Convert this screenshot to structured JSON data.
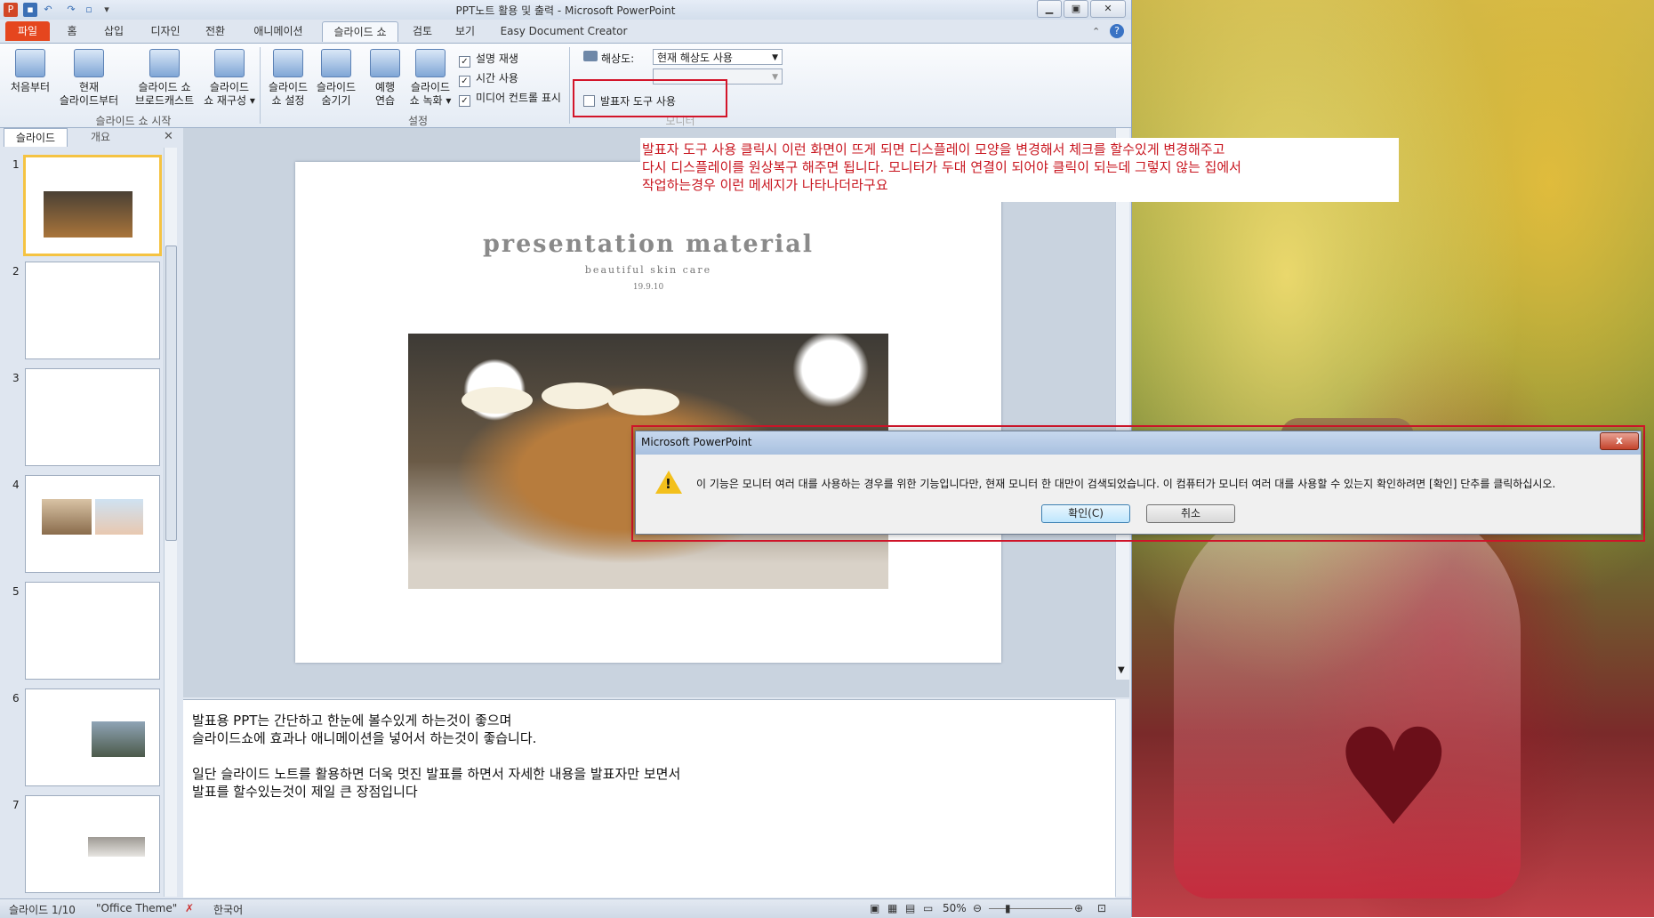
{
  "window": {
    "title": "PPT노트 활용 및 출력 - Microsoft PowerPoint",
    "min_icon": "minimize-icon",
    "max_icon": "maximize-icon",
    "close_icon": "close-icon"
  },
  "tabs": [
    "파일",
    "홈",
    "삽입",
    "디자인",
    "전환",
    "애니메이션",
    "슬라이드 쇼",
    "검토",
    "보기",
    "Easy Document Creator"
  ],
  "ribbon": {
    "buttons": [
      {
        "label1": "처음부터",
        "label2": ""
      },
      {
        "label1": "현재",
        "label2": "슬라이드부터"
      },
      {
        "label1": "슬라이드 쇼",
        "label2": "브로드캐스트"
      },
      {
        "label1": "슬라이드",
        "label2": "쇼 재구성 ▾"
      },
      {
        "label1": "슬라이드",
        "label2": "쇼 설정"
      },
      {
        "label1": "슬라이드",
        "label2": "숨기기"
      },
      {
        "label1": "예행",
        "label2": "연습"
      },
      {
        "label1": "슬라이드",
        "label2": "쇼 녹화 ▾"
      }
    ],
    "group_start": "슬라이드 쇼 시작",
    "group_settings": "설정",
    "group_monitor": "모니터",
    "check_narration": "설명 재생",
    "check_timing": "시간 사용",
    "check_media": "미디어 컨트롤 표시",
    "resolution_label": "해상도:",
    "resolution_value": "현재 해상도 사용",
    "show_on_value": "",
    "presenter_view": "발표자 도구 사용"
  },
  "left_pane": {
    "tab_slides": "슬라이드",
    "tab_outline": "개요",
    "slide_numbers": [
      "1",
      "2",
      "3",
      "4",
      "5",
      "6",
      "7"
    ]
  },
  "slide": {
    "title": "presentation   material",
    "subtitle": "beautiful skin care",
    "date": "19.9.10"
  },
  "annotation": {
    "line1": "발표자 도구 사용 클릭시 이런 화면이 뜨게 되면 디스플레이 모양을 변경해서 체크를 할수있게 변경해주고",
    "line2": "다시 디스플레이를 원상복구 해주면 됩니다. 모니터가 두대 연결이 되어야 클릭이 되는데 그렇지 않는 집에서",
    "line3": "작업하는경우 이런 메세지가 나타나더라구요"
  },
  "notes": {
    "line1": "발표용 PPT는 간단하고 한눈에 볼수있게 하는것이 좋으며",
    "line2": "슬라이드쇼에 효과나 애니메이션을 넣어서 하는것이 좋습니다.",
    "line3": "일단 슬라이드 노트를 활용하면 더욱 멋진 발표를 하면서 자세한 내용을 발표자만 보면서",
    "line4": "발표를 할수있는것이 제일 큰 장점입니다"
  },
  "status": {
    "slide": "슬라이드 1/10",
    "theme": "\"Office Theme\"",
    "language": "한국어",
    "zoom": "50%"
  },
  "dialog": {
    "title": "Microsoft PowerPoint",
    "message": "이 기능은 모니터 여러 대를 사용하는 경우를 위한 기능입니다만, 현재 모니터 한 대만이 검색되었습니다. 이 컴퓨터가 모니터 여러 대를 사용할 수 있는지 확인하려면 [확인] 단추를 클릭하십시오.",
    "ok": "확인(C)",
    "cancel": "취소",
    "close_glyph": "x"
  },
  "colors": {
    "file_tab": "#e5461e",
    "annotation_text": "#c8141e",
    "highlight_box": "#d3152a"
  }
}
